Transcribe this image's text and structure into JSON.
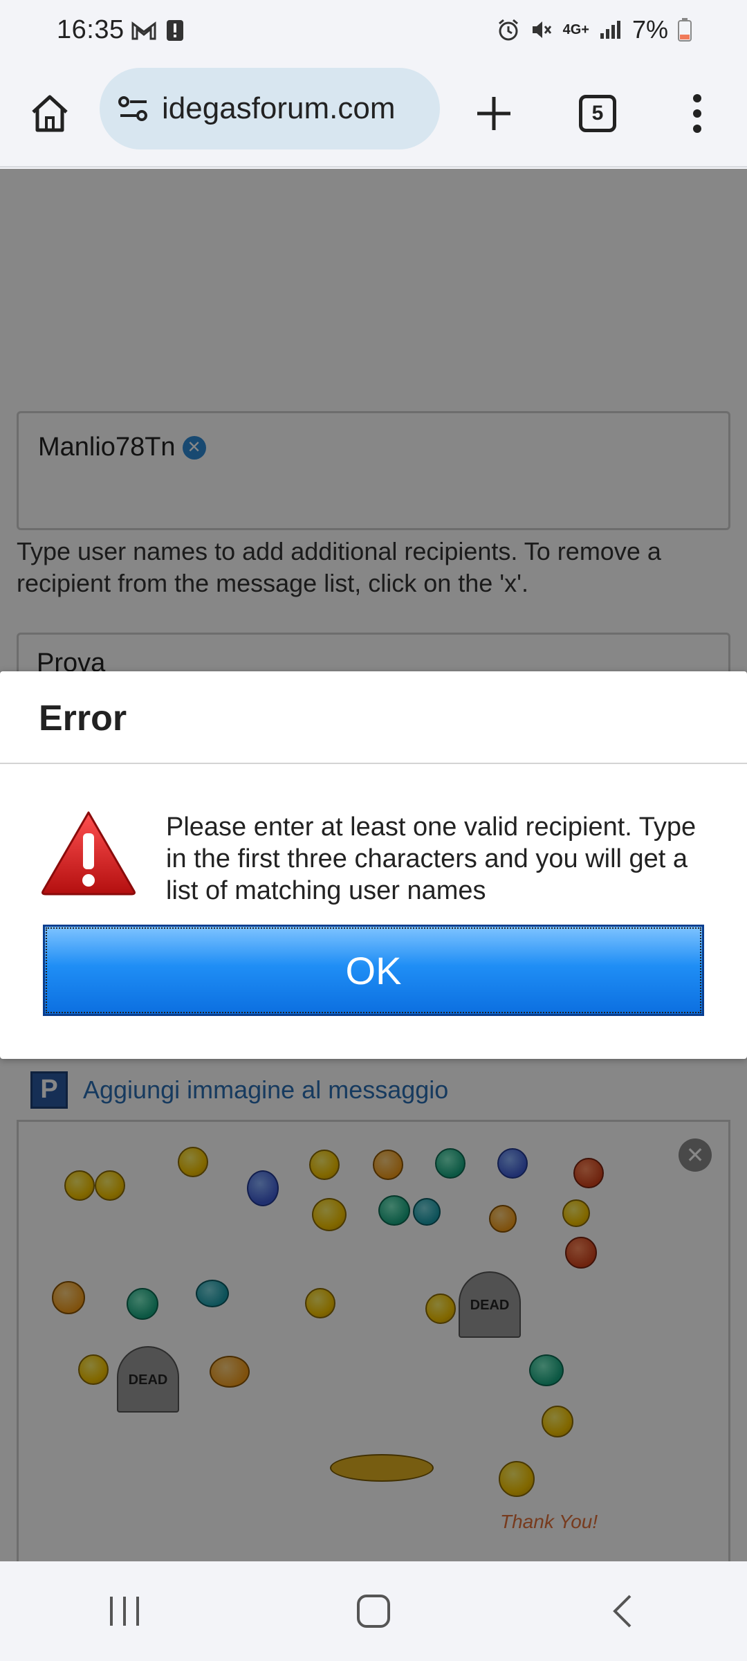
{
  "status_bar": {
    "time": "16:35",
    "battery": "7%",
    "network": "4G+"
  },
  "browser": {
    "url": "idegasforum.com",
    "tab_count": "5"
  },
  "compose": {
    "recipient_chip": "Manlio78Tn",
    "recipients_help": "Type user names to add additional recipients. To remove a recipient from the message list, click on the 'x'.",
    "subject_value": "Prova",
    "add_image_label": "Aggiungi immagine al messaggio"
  },
  "smileys": {
    "dead_label": "DEAD",
    "thank_you_label": "Thank You!"
  },
  "dialog": {
    "title": "Error",
    "message": "Please enter at least one valid recipient. Type in the first three characters and you will get a list of matching user names",
    "ok_label": "OK"
  },
  "colors": {
    "ok_button": "#1f8ef5",
    "link": "#2a6fb3",
    "warning_icon": "#d42020"
  }
}
